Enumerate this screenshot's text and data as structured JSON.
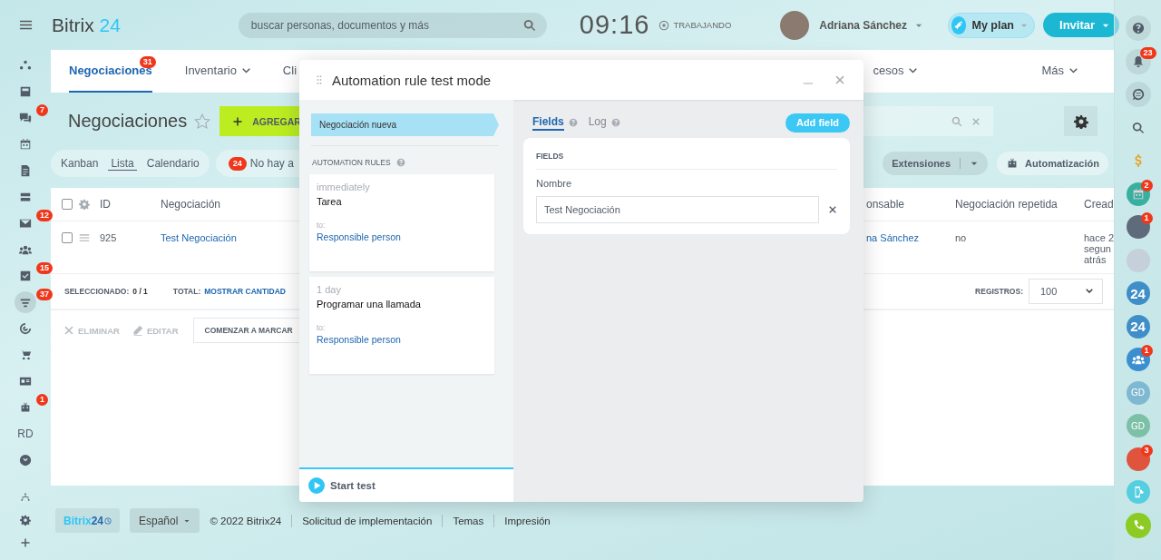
{
  "header": {
    "logo": {
      "name": "Bitrix",
      "number": "24"
    },
    "search": {
      "placeholder": "buscar personas, documentos y más"
    },
    "clock": "09:16",
    "work_status": "TRABAJANDO",
    "user_name": "Adriana Sánchez",
    "plan_button": "My plan",
    "invite_button": "Invitar"
  },
  "left_sidebar": {
    "items": [
      {
        "kind": "widget",
        "selected": false
      },
      {
        "kind": "feed",
        "selected": false
      },
      {
        "kind": "chat",
        "badge": "7",
        "selected": false
      },
      {
        "kind": "calendar",
        "selected": false
      },
      {
        "kind": "document",
        "selected": false
      },
      {
        "kind": "drive",
        "selected": false
      },
      {
        "kind": "mail",
        "badge": "12",
        "selected": false
      },
      {
        "kind": "people",
        "selected": false
      },
      {
        "kind": "tasks",
        "badge": "15",
        "selected": false
      },
      {
        "kind": "funnel",
        "badge": "37",
        "selected": true
      },
      {
        "kind": "target",
        "selected": false
      },
      {
        "kind": "cart",
        "selected": false
      },
      {
        "kind": "contact",
        "selected": false
      },
      {
        "kind": "robot",
        "badge": "1",
        "selected": false
      },
      {
        "kind": "text",
        "label": "RD",
        "selected": false
      },
      {
        "kind": "more",
        "selected": false
      }
    ],
    "bottom_items": [
      {
        "kind": "sitemap"
      },
      {
        "kind": "gear"
      },
      {
        "kind": "plus"
      }
    ]
  },
  "nav_tabs": {
    "left": [
      {
        "label": "Negociaciones",
        "badge": "31",
        "dropdown": false,
        "selected": true
      },
      {
        "label": "Inventario",
        "dropdown": true,
        "selected": false
      },
      {
        "label": "Cli",
        "dropdown": false,
        "selected": false
      }
    ],
    "right": [
      {
        "label": "cesos",
        "dropdown": true,
        "selected": false
      },
      {
        "label": "Más",
        "dropdown": true,
        "selected": false
      }
    ]
  },
  "page_title": "Negociaciones",
  "add_button": "AGREGAR",
  "views": [
    {
      "label": "Kanban",
      "selected": false
    },
    {
      "label": "Lista",
      "selected": true
    },
    {
      "label": "Calendario",
      "selected": false
    }
  ],
  "counter": {
    "badge": "24",
    "text": "No hay a"
  },
  "extensions_button": "Extensiones",
  "automation_button": "Automatización",
  "table": {
    "select_all_checked": false,
    "columns_left": [
      "ID",
      "Negociación"
    ],
    "columns_right": [
      "onsable",
      "Negociación repetida",
      "Cread"
    ],
    "rows": [
      {
        "checked": false,
        "id": "925",
        "name": "Test Negociación",
        "responsible": "na Sánchez",
        "repeated": "no",
        "created": [
          "hace 2",
          "segun",
          "atrás"
        ]
      }
    ]
  },
  "summary": {
    "selected_label": "SELECCIONADO:",
    "selected_value": "0 / 1",
    "total_label": "TOTAL:",
    "total_link": "MOSTRAR CANTIDAD",
    "records_label": "REGISTROS:",
    "records_value": "100"
  },
  "actions": [
    {
      "kind": "delete",
      "label": "ELIMINAR",
      "disabled": true
    },
    {
      "kind": "edit",
      "label": "EDITAR",
      "disabled": true
    },
    {
      "kind": "button",
      "label": "COMENZAR A MARCAR",
      "disabled": false
    }
  ],
  "footer": {
    "logo": {
      "name": "Bitrix",
      "number": "24"
    },
    "language": "Español",
    "copyright": "© 2022 Bitrix24",
    "links": [
      "Solicitud de implementación",
      "Temas",
      "Impresión"
    ]
  },
  "right_bar": {
    "items": [
      {
        "kind": "help"
      },
      {
        "kind": "bell",
        "badge": "23"
      },
      {
        "kind": "chat"
      },
      {
        "kind": "search"
      },
      {
        "kind": "dollar"
      },
      {
        "kind": "calendar",
        "badge": "2"
      },
      {
        "kind": "avatar",
        "badge": "1",
        "color": "#5d6b7c"
      },
      {
        "kind": "avatar",
        "color": "#c5d0da"
      },
      {
        "kind": "app",
        "label": "24"
      },
      {
        "kind": "app",
        "label": "24"
      },
      {
        "kind": "group",
        "badge": "1"
      },
      {
        "kind": "initials",
        "label": "GD",
        "color": "#7fb8d1"
      },
      {
        "kind": "initials",
        "label": "GD",
        "color": "#7cc1a5"
      },
      {
        "kind": "avatar",
        "badge": "3",
        "color": "#e0533c"
      },
      {
        "kind": "mobile"
      },
      {
        "kind": "call"
      }
    ]
  },
  "modal": {
    "title": "Automation rule test mode",
    "stage": "Negociación nueva",
    "rules_heading": "AUTOMATION RULES",
    "rules": [
      {
        "delay": "immediately",
        "name": "Tarea",
        "to_label": "to:",
        "assignee": "Responsible person"
      },
      {
        "delay": "1 day",
        "name": "Programar una llamada",
        "to_label": "to:",
        "assignee": "Responsible person"
      }
    ],
    "start_button": "Start test",
    "tabs": [
      {
        "label": "Fields",
        "selected": true
      },
      {
        "label": "Log",
        "selected": false
      }
    ],
    "add_field_button": "Add field",
    "fields_heading": "FIELDS",
    "fields": [
      {
        "label": "Nombre",
        "value": "Test Negociación"
      }
    ]
  }
}
